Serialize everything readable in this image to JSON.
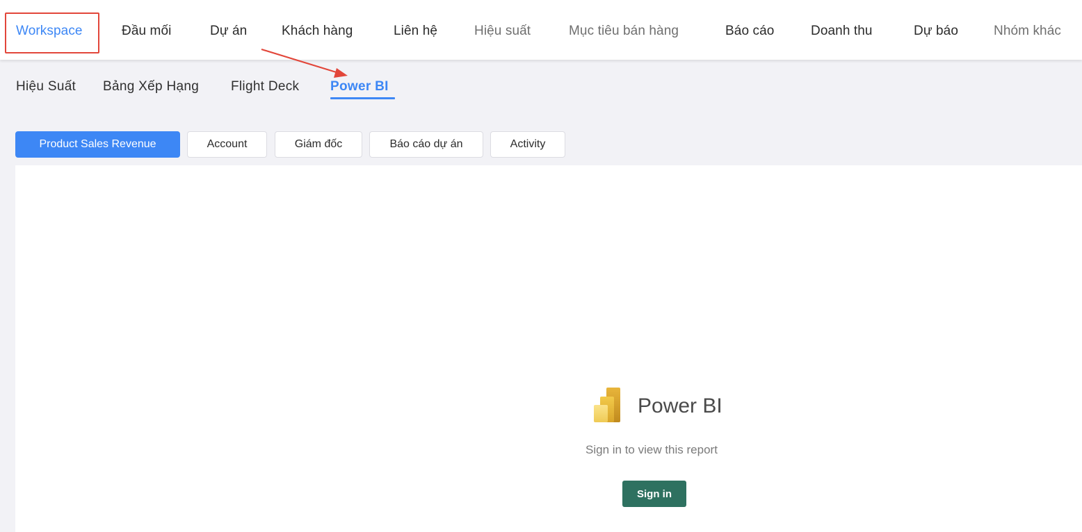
{
  "top_nav": {
    "items": [
      {
        "label": "Workspace"
      },
      {
        "label": "Đầu mối"
      },
      {
        "label": "Dự án"
      },
      {
        "label": "Khách hàng"
      },
      {
        "label": "Liên hệ"
      },
      {
        "label": "Hiệu suất"
      },
      {
        "label": "Mục tiêu bán hàng"
      },
      {
        "label": "Báo cáo"
      },
      {
        "label": "Doanh thu"
      },
      {
        "label": "Dự báo"
      },
      {
        "label": "Nhóm khác"
      }
    ]
  },
  "sub_nav": {
    "items": [
      {
        "label": "Hiệu Suất"
      },
      {
        "label": "Bảng Xếp Hạng"
      },
      {
        "label": "Flight Deck"
      },
      {
        "label": "Power BI"
      }
    ]
  },
  "report_tabs": {
    "items": [
      {
        "label": "Product Sales Revenue"
      },
      {
        "label": "Account"
      },
      {
        "label": "Giám đốc"
      },
      {
        "label": "Báo cáo dự án"
      },
      {
        "label": "Activity"
      }
    ]
  },
  "report": {
    "brand": "Power BI",
    "message": "Sign in to view this report",
    "signin_label": "Sign in"
  },
  "colors": {
    "accent": "#3d87f5",
    "annotation": "#e2463a",
    "signin_button": "#2e7160"
  },
  "icons": {
    "brand_logo": "power-bi-logo-icon"
  }
}
